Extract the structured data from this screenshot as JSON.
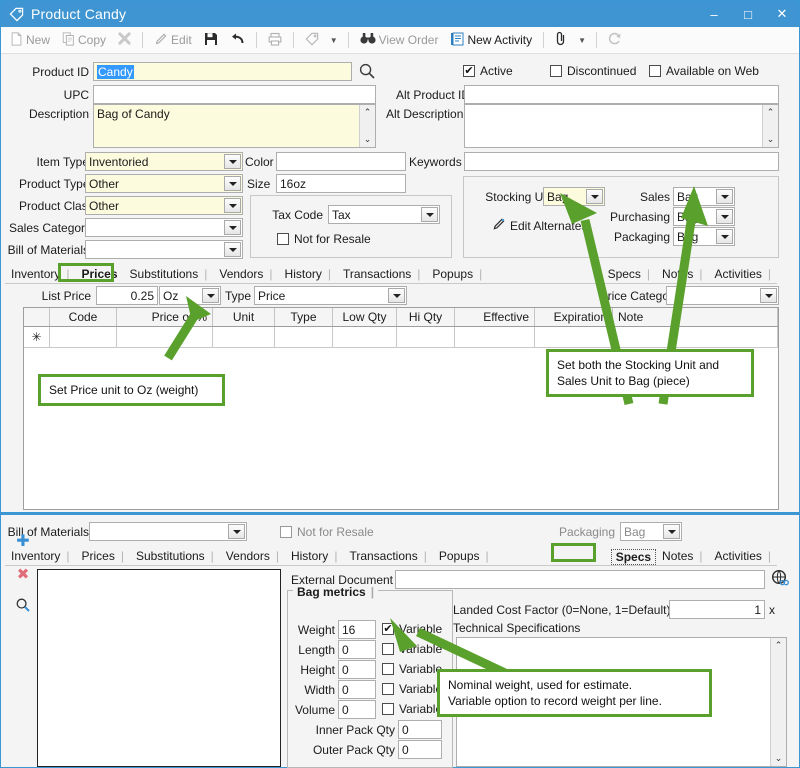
{
  "window": {
    "title": "Product Candy",
    "icon": "tag-icon",
    "minimize": "–",
    "maximize": "□",
    "close": "✕"
  },
  "toolbar": {
    "items": [
      {
        "label": "New",
        "icon": "new-document-icon",
        "enabled": false
      },
      {
        "label": "Copy",
        "icon": "copy-icon",
        "enabled": false
      },
      {
        "label": "",
        "icon": "delete-x-icon",
        "enabled": false
      },
      {
        "label": "Edit",
        "icon": "pencil-icon",
        "enabled": false
      },
      {
        "label": "",
        "icon": "save-disk-icon",
        "enabled": true
      },
      {
        "label": "",
        "icon": "undo-arrow-icon",
        "enabled": true
      },
      {
        "label": "",
        "icon": "print-icon",
        "enabled": false
      },
      {
        "label": "",
        "icon": "tag-icon",
        "enabled": false
      },
      {
        "label": "View Order",
        "icon": "binoculars-icon",
        "enabled": false
      },
      {
        "label": "New Activity",
        "icon": "notebook-icon",
        "enabled": true
      },
      {
        "label": "",
        "icon": "paperclip-icon",
        "enabled": true
      },
      {
        "label": "",
        "icon": "refresh-icon",
        "enabled": false
      }
    ]
  },
  "form": {
    "product_id_label": "Product ID",
    "product_id_value": "Candy",
    "search_icon": "magnifier-icon",
    "upc_label": "UPC",
    "upc_value": "",
    "description_label": "Description",
    "description_value": "Bag of Candy",
    "item_type_label": "Item Type",
    "item_type_value": "Inventoried",
    "product_type_label": "Product Type",
    "product_type_value": "Other",
    "product_class_label": "Product Class",
    "product_class_value": "Other",
    "sales_category_label": "Sales Category",
    "sales_category_value": "",
    "bill_of_materials_label": "Bill of Materials",
    "bill_of_materials_value": "",
    "color_label": "Color",
    "color_value": "",
    "size_label": "Size",
    "size_value": "16oz",
    "alt_product_id_label": "Alt Product ID",
    "alt_product_id_value": "",
    "alt_description_label": "Alt Description",
    "alt_description_value": "",
    "keywords_label": "Keywords",
    "keywords_value": "",
    "tax_code_label": "Tax Code",
    "tax_code_value": "Tax",
    "not_for_resale_label": "Not for Resale",
    "not_for_resale_checked": false,
    "active_label": "Active",
    "active_checked": true,
    "discontinued_label": "Discontinued",
    "discontinued_checked": false,
    "available_on_web_label": "Available on Web",
    "available_on_web_checked": false
  },
  "units": {
    "stocking_unit_label": "Stocking Unit",
    "stocking_unit_value": "Bag",
    "sales_label": "Sales",
    "sales_value": "Bag",
    "purchasing_label": "Purchasing",
    "purchasing_value": "Bag",
    "packaging_label": "Packaging",
    "packaging_value": "Bag",
    "edit_alternates_label": "Edit Alternates",
    "edit_alternates_icon": "pencil-icon"
  },
  "main_tabs": {
    "left": [
      {
        "label": "Inventory",
        "selected": false
      },
      {
        "label": "Prices",
        "selected": true
      },
      {
        "label": "Substitutions",
        "selected": false
      },
      {
        "label": "Vendors",
        "selected": false
      },
      {
        "label": "History",
        "selected": false
      },
      {
        "label": "Transactions",
        "selected": false
      },
      {
        "label": "Popups",
        "selected": false
      }
    ],
    "right": [
      {
        "label": "Specs",
        "selected": false
      },
      {
        "label": "Notes",
        "selected": false
      },
      {
        "label": "Activities",
        "selected": false
      }
    ]
  },
  "prices": {
    "list_price_label": "List Price",
    "list_price_value": "0.25",
    "unit_value": "Oz",
    "type_label": "Type",
    "type_value": "Price",
    "price_category_label": "Price Category",
    "price_category_value": "",
    "columns": [
      "Code",
      "Price or %",
      "Unit",
      "Type",
      "Low Qty",
      "Hi Qty",
      "Effective",
      "Expiration",
      "Note"
    ],
    "new_row_marker": "✳",
    "rows": []
  },
  "callouts": [
    {
      "name": "price-unit-callout",
      "text": "Set Price unit to Oz (weight)"
    },
    {
      "name": "stocking-sales-unit-callout",
      "line1": "Set both the Stocking Unit and",
      "line2": "Sales Unit to Bag (piece)"
    },
    {
      "name": "weight-variable-callout",
      "line1": "Nominal weight, used for estimate.",
      "line2": "Variable option to record weight per line."
    }
  ],
  "lower": {
    "bill_of_materials_label": "Bill of Materials",
    "not_for_resale_label": "Not for Resale",
    "packaging_label": "Packaging",
    "packaging_value": "Bag",
    "tabs_left": [
      {
        "label": "Inventory",
        "selected": false
      },
      {
        "label": "Prices",
        "selected": false
      },
      {
        "label": "Substitutions",
        "selected": false
      },
      {
        "label": "Vendors",
        "selected": false
      },
      {
        "label": "History",
        "selected": false
      },
      {
        "label": "Transactions",
        "selected": false
      },
      {
        "label": "Popups",
        "selected": false
      }
    ],
    "tabs_right": [
      {
        "label": "Specs",
        "selected": true
      },
      {
        "label": "Notes",
        "selected": false
      },
      {
        "label": "Activities",
        "selected": false
      }
    ],
    "side_icons": [
      {
        "name": "add-plus-icon",
        "glyph": "✚"
      },
      {
        "name": "delete-x-icon",
        "glyph": "✖"
      },
      {
        "name": "search-magnifier-icon",
        "glyph": "⌕"
      }
    ],
    "external_document_label": "External Document",
    "external_document_value": "",
    "globe_icon": "globe-web-icon",
    "landed_cost_label": "Landed Cost Factor (0=None, 1=Default)",
    "landed_cost_value": "1",
    "landed_cost_suffix": "x",
    "technical_specifications_label": "Technical Specifications",
    "technical_specifications_value": "",
    "metrics_tab_label": "Bag metrics",
    "metrics": [
      {
        "label": "Weight",
        "value": "16",
        "variable_label": "Variable",
        "variable_checked": true
      },
      {
        "label": "Length",
        "value": "0",
        "variable_label": "Variable",
        "variable_checked": false
      },
      {
        "label": "Height",
        "value": "0",
        "variable_label": "Variable",
        "variable_checked": false
      },
      {
        "label": "Width",
        "value": "0",
        "variable_label": "Variable",
        "variable_checked": false
      },
      {
        "label": "Volume",
        "value": "0",
        "variable_label": "Variable",
        "variable_checked": false
      }
    ],
    "inner_pack_label": "Inner Pack Qty",
    "inner_pack_value": "0",
    "outer_pack_label": "Outer Pack Qty",
    "outer_pack_value": "0"
  },
  "colors": {
    "accent": "#3f95d2",
    "callout_green": "#5aa02c",
    "field_yellow": "#fdfbdd"
  }
}
